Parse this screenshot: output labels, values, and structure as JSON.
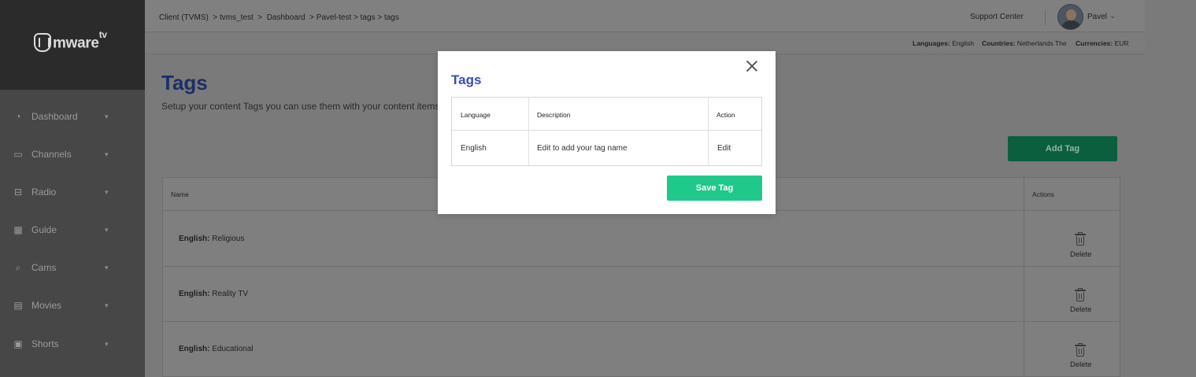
{
  "sidebar": {
    "logo_text": "mware",
    "logo_sup": "tv",
    "items": [
      {
        "label": "Dashboard",
        "icon": "dashboard-icon"
      },
      {
        "label": "Channels",
        "icon": "monitor-icon"
      },
      {
        "label": "Radio",
        "icon": "radio-icon"
      },
      {
        "label": "Guide",
        "icon": "guide-icon"
      },
      {
        "label": "Cams",
        "icon": "cams-icon"
      },
      {
        "label": "Movies",
        "icon": "film-icon"
      },
      {
        "label": "Shorts",
        "icon": "shorts-icon"
      }
    ]
  },
  "header": {
    "breadcrumb": "Client (TVMS)  > tvms_test  >  Dashboard  > Pavel-test > tags > tags",
    "support": "Support Center",
    "user_name": "Pavel"
  },
  "infobar": {
    "languages_label": "Languages:",
    "languages_value": " English",
    "countries_label": "Countries:",
    "countries_value": " Netherlands The",
    "currencies_label": "Currencies:",
    "currencies_value": " EUR"
  },
  "page": {
    "title": "Tags",
    "subtitle": "Setup your content Tags you can use them with your content items you c",
    "add_button": "Add Tag"
  },
  "table": {
    "col_name": "Name",
    "col_actions": "Actions",
    "rows": [
      {
        "lang": "English:",
        "value": " Religious",
        "action": "Delete"
      },
      {
        "lang": "English:",
        "value": " Reality TV",
        "action": "Delete"
      },
      {
        "lang": "English:",
        "value": " Educational",
        "action": "Delete"
      }
    ]
  },
  "modal": {
    "title": "Tags",
    "headers": [
      "Language",
      "Description",
      "Action"
    ],
    "row": [
      "English",
      "Edit to add your tag name",
      "Edit"
    ],
    "save_button": "Save Tag"
  },
  "colors": {
    "accent_green": "#1fc98a",
    "title_blue": "#3b4bb5",
    "sidebar_bg": "#474747"
  }
}
